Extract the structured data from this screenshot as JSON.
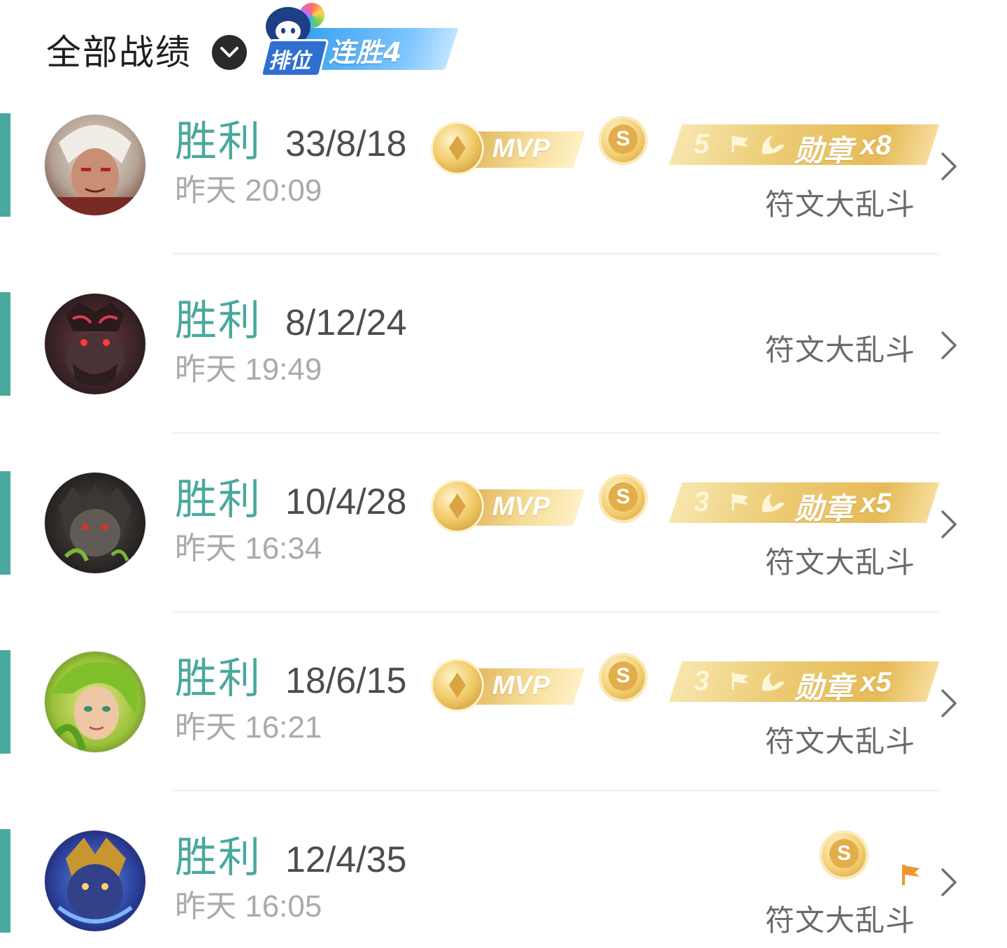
{
  "header": {
    "title": "全部战绩",
    "streak_badge": "排位",
    "streak_text": "连胜4"
  },
  "colors": {
    "win": "#4aa89e",
    "gold": "#e6bb58",
    "streak_blue": "#3aa2f0"
  },
  "matches": [
    {
      "result": "胜利",
      "kda": "33/8/18",
      "time": "昨天 20:09",
      "mode": "符文大乱斗",
      "mvp": true,
      "mvp_label": "MVP",
      "s_badge": true,
      "s_label": "S",
      "medal": true,
      "medal_num": "5",
      "medal_text": "勋章",
      "medal_count": "x8",
      "avatar_icon": "white-hair-champion-avatar"
    },
    {
      "result": "胜利",
      "kda": "8/12/24",
      "time": "昨天 19:49",
      "mode": "符文大乱斗",
      "mvp": false,
      "s_badge": false,
      "medal": false,
      "avatar_icon": "ornn-avatar"
    },
    {
      "result": "胜利",
      "kda": "10/4/28",
      "time": "昨天 16:34",
      "mode": "符文大乱斗",
      "mvp": true,
      "mvp_label": "MVP",
      "s_badge": true,
      "s_label": "S",
      "medal": true,
      "medal_num": "3",
      "medal_text": "勋章",
      "medal_count": "x5",
      "avatar_icon": "warwick-avatar"
    },
    {
      "result": "胜利",
      "kda": "18/6/15",
      "time": "昨天 16:21",
      "mode": "符文大乱斗",
      "mvp": true,
      "mvp_label": "MVP",
      "s_badge": true,
      "s_label": "S",
      "medal": true,
      "medal_num": "3",
      "medal_text": "勋章",
      "medal_count": "x5",
      "avatar_icon": "zyra-avatar"
    },
    {
      "result": "胜利",
      "kda": "12/4/35",
      "time": "昨天 16:05",
      "mode": "符文大乱斗",
      "mvp": false,
      "s_badge": true,
      "s_label": "S",
      "medal": false,
      "surrender_flag": true,
      "avatar_icon": "aurelion-sol-avatar"
    }
  ]
}
